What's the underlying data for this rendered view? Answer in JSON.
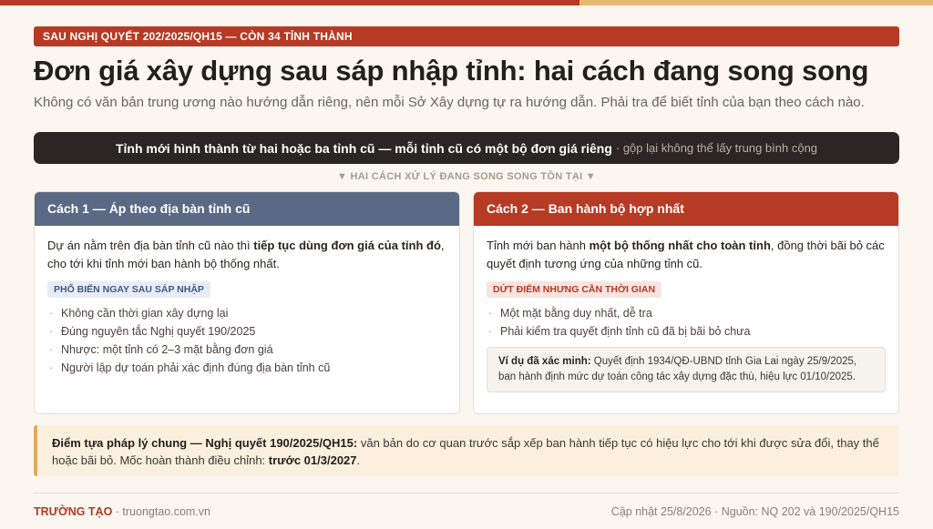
{
  "header": {
    "tagline": "SAU NGHỊ QUYẾT 202/2025/QH15 — CÒN 34 TỈNH THÀNH",
    "title": "Đơn giá xây dựng sau sáp nhập tỉnh: hai cách đang song song",
    "subtitle": "Không có văn bản trung ương nào hướng dẫn riêng, nên mỗi Sở Xây dựng tự ra hướng dẫn. Phải tra để biết tỉnh của bạn theo cách nào."
  },
  "banner": {
    "strong": "Tỉnh mới hình thành từ hai hoặc ba tỉnh cũ — mỗi tỉnh cũ có một bộ đơn giá riêng",
    "light": "· gộp lại không thể lấy trung bình cộng"
  },
  "divider": "▼ HAI CÁCH XỬ LÝ ĐANG SONG SONG TỒN TẠI ▼",
  "card1": {
    "title": "Cách 1 — Áp theo địa bàn tỉnh cũ",
    "desc_a": "Dự án nằm trên địa bàn tỉnh cũ nào thì ",
    "desc_b": "tiếp tục dùng đơn giá của tỉnh đó",
    "desc_c": ", cho tới khi tỉnh mới ban hành bộ thống nhất.",
    "tag": "PHỔ BIẾN NGAY SAU SÁP NHẬP",
    "bullets": [
      "Không cần thời gian xây dựng lại",
      "Đúng nguyên tắc Nghị quyết 190/2025",
      "Nhược: một tỉnh có 2–3 mặt bằng đơn giá",
      "Người lập dự toán phải xác định đúng địa bàn tỉnh cũ"
    ]
  },
  "card2": {
    "title": "Cách 2 — Ban hành bộ hợp nhất",
    "desc_a": "Tỉnh mới ban hành ",
    "desc_b": "một bộ thống nhất cho toàn tỉnh",
    "desc_c": ", đồng thời bãi bỏ các quyết định tương ứng của những tỉnh cũ.",
    "tag": "DỨT ĐIỂM NHƯNG CẦN THỜI GIAN",
    "bullets": [
      "Một mặt bằng duy nhất, dễ tra",
      "Phải kiểm tra quyết định tỉnh cũ đã bị bãi bỏ chưa"
    ],
    "example_label": "Ví dụ đã xác minh:",
    "example_text": " Quyết định 1934/QĐ-UBND tỉnh Gia Lai ngày 25/9/2025, ban hành định mức dự toán công tác xây dựng đặc thù, hiệu lực 01/10/2025."
  },
  "legal": {
    "label": "Điểm tựa pháp lý chung — Nghị quyết 190/2025/QH15:",
    "text": " văn bản do cơ quan trước sắp xếp ban hành tiếp tục có hiệu lực cho tới khi được sửa đổi, thay thế hoặc bãi bỏ. Mốc hoàn thành điều chỉnh: ",
    "deadline": "trước 01/3/2027",
    "end": "."
  },
  "footer": {
    "brand": "TRƯỜNG TẠO",
    "site": " · truongtao.com.vn",
    "right": "Cập nhật 25/8/2026 · Nguồn: NQ 202 và 190/2025/QH15"
  },
  "colors": {
    "accent_red": "#b63a24",
    "accent_slate": "#5a6a85",
    "accent_gold": "#e0ab5b",
    "dark": "#2b2623",
    "background": "#fbf6ef"
  }
}
